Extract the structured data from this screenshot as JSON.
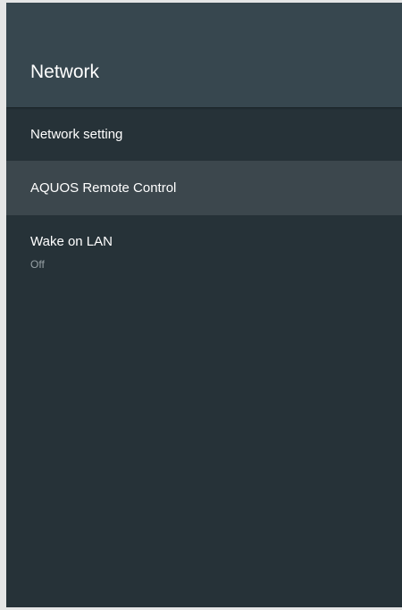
{
  "header": {
    "title": "Network"
  },
  "items": [
    {
      "label": "Network setting"
    },
    {
      "label": "AQUOS Remote Control",
      "selected": true
    },
    {
      "label": "Wake on LAN",
      "value": "Off"
    }
  ],
  "colors": {
    "panel_bg": "#263238",
    "header_bg": "#37474f",
    "selected_bg": "#3c474d",
    "text_primary": "#ffffff",
    "text_secondary": "#97a1a5"
  }
}
